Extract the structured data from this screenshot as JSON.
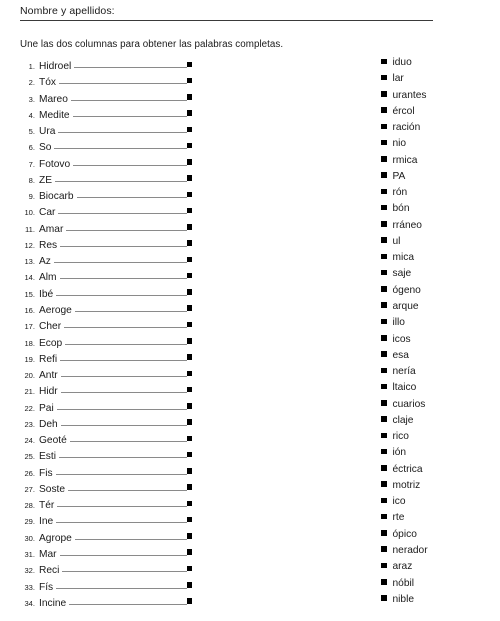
{
  "header": {
    "name_label": "Nombre y apellidos:"
  },
  "instruction": "Une las dos columnas para obtener las palabras completas.",
  "exercise": {
    "left_column": [
      {
        "number": "1.",
        "prefix": "Hidroel"
      },
      {
        "number": "2.",
        "prefix": "Tóx"
      },
      {
        "number": "3.",
        "prefix": "Mareo"
      },
      {
        "number": "4.",
        "prefix": "Medite"
      },
      {
        "number": "5.",
        "prefix": "Ura"
      },
      {
        "number": "6.",
        "prefix": "So"
      },
      {
        "number": "7.",
        "prefix": "Fotovo"
      },
      {
        "number": "8.",
        "prefix": "ZE"
      },
      {
        "number": "9.",
        "prefix": "Biocarb"
      },
      {
        "number": "10.",
        "prefix": "Car"
      },
      {
        "number": "11.",
        "prefix": "Amar"
      },
      {
        "number": "12.",
        "prefix": "Res"
      },
      {
        "number": "13.",
        "prefix": "Az"
      },
      {
        "number": "14.",
        "prefix": "Alm"
      },
      {
        "number": "15.",
        "prefix": "Ibé"
      },
      {
        "number": "16.",
        "prefix": "Aeroge"
      },
      {
        "number": "17.",
        "prefix": "Cher"
      },
      {
        "number": "18.",
        "prefix": "Ecop"
      },
      {
        "number": "19.",
        "prefix": "Refi"
      },
      {
        "number": "20.",
        "prefix": "Antr"
      },
      {
        "number": "21.",
        "prefix": "Hidr"
      },
      {
        "number": "22.",
        "prefix": "Pai"
      },
      {
        "number": "23.",
        "prefix": "Deh"
      },
      {
        "number": "24.",
        "prefix": "Geoté"
      },
      {
        "number": "25.",
        "prefix": "Esti"
      },
      {
        "number": "26.",
        "prefix": "Fis"
      },
      {
        "number": "27.",
        "prefix": "Soste"
      },
      {
        "number": "28.",
        "prefix": "Tér"
      },
      {
        "number": "29.",
        "prefix": "Ine"
      },
      {
        "number": "30.",
        "prefix": "Agrope"
      },
      {
        "number": "31.",
        "prefix": "Mar"
      },
      {
        "number": "32.",
        "prefix": "Reci"
      },
      {
        "number": "33.",
        "prefix": "Fís"
      },
      {
        "number": "34.",
        "prefix": "Incine"
      }
    ],
    "right_column": [
      {
        "suffix": "iduo"
      },
      {
        "suffix": "lar"
      },
      {
        "suffix": "urantes"
      },
      {
        "suffix": "ércol"
      },
      {
        "suffix": "ración"
      },
      {
        "suffix": "nio"
      },
      {
        "suffix": "rmica"
      },
      {
        "suffix": "PA"
      },
      {
        "suffix": "rón"
      },
      {
        "suffix": "bón"
      },
      {
        "suffix": "rráneo"
      },
      {
        "suffix": "ul"
      },
      {
        "suffix": "mica"
      },
      {
        "suffix": "saje"
      },
      {
        "suffix": "ógeno"
      },
      {
        "suffix": "arque"
      },
      {
        "suffix": "illo"
      },
      {
        "suffix": "icos"
      },
      {
        "suffix": "esa"
      },
      {
        "suffix": "nería"
      },
      {
        "suffix": "ltaico"
      },
      {
        "suffix": "cuarios"
      },
      {
        "suffix": "claje"
      },
      {
        "suffix": "rico"
      },
      {
        "suffix": "ión"
      },
      {
        "suffix": "éctrica"
      },
      {
        "suffix": "motriz"
      },
      {
        "suffix": "ico"
      },
      {
        "suffix": "rte"
      },
      {
        "suffix": "ópico"
      },
      {
        "suffix": "nerador"
      },
      {
        "suffix": "araz"
      },
      {
        "suffix": "nóbil"
      },
      {
        "suffix": "nible"
      }
    ]
  }
}
